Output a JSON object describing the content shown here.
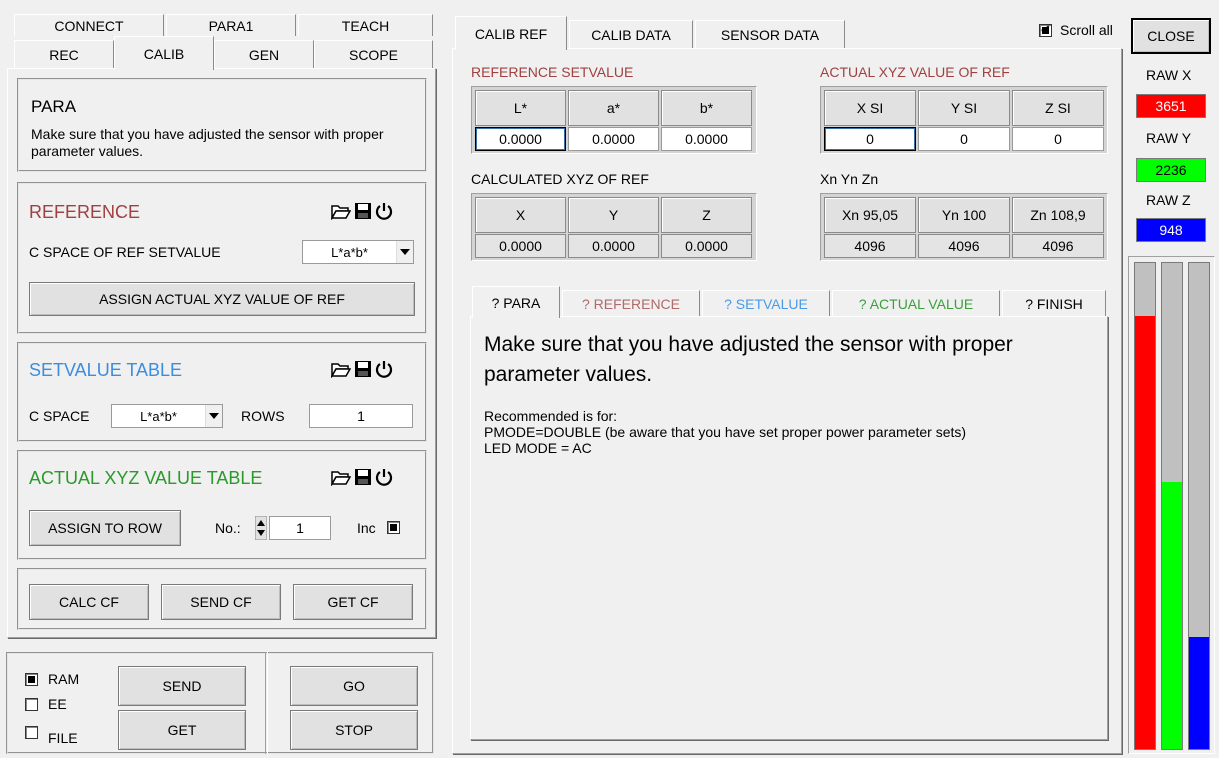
{
  "left_tabs": {
    "row1": [
      "CONNECT",
      "PARA1",
      "TEACH"
    ],
    "row2": [
      "REC",
      "CALIB",
      "GEN",
      "SCOPE"
    ],
    "active": "CALIB"
  },
  "para": {
    "title": "PARA",
    "text": "Make sure that you have adjusted the sensor with proper parameter values."
  },
  "reference": {
    "title": "REFERENCE",
    "title_color": "#a04040",
    "cspace_label": "C SPACE OF REF SETVALUE",
    "cspace_value": "L*a*b*",
    "assign_button": "ASSIGN ACTUAL XYZ VALUE OF REF"
  },
  "setvalue_table": {
    "title": "SETVALUE TABLE",
    "title_color": "#3c8ce0",
    "cspace_label": "C SPACE",
    "cspace_value": "L*a*b*",
    "rows_label": "ROWS",
    "rows_value": "1"
  },
  "actual_table": {
    "title": "ACTUAL XYZ VALUE TABLE",
    "title_color": "#2a9a2a",
    "assign_button": "ASSIGN TO ROW",
    "no_label": "No.:",
    "no_value": "1",
    "inc_label": "Inc"
  },
  "cf_buttons": {
    "calc": "CALC CF",
    "send": "SEND CF",
    "get": "GET CF"
  },
  "bottom": {
    "ram": "RAM",
    "ee": "EE",
    "file": "FILE",
    "send": "SEND",
    "get": "GET",
    "go": "GO",
    "stop": "STOP"
  },
  "right_tabs": [
    "CALIB REF",
    "CALIB DATA",
    "SENSOR DATA"
  ],
  "scroll_all": "Scroll all",
  "close": "CLOSE",
  "ref_setvalue": {
    "title": "REFERENCE SETVALUE",
    "headers": [
      "L*",
      "a*",
      "b*"
    ],
    "values": [
      "0.0000",
      "0.0000",
      "0.0000"
    ]
  },
  "actual_xyz_ref": {
    "title": "ACTUAL XYZ VALUE OF REF",
    "headers": [
      "X SI",
      "Y SI",
      "Z SI"
    ],
    "values": [
      "0",
      "0",
      "0"
    ]
  },
  "calc_xyz_ref": {
    "title": "CALCULATED XYZ  OF REF",
    "headers": [
      "X",
      "Y",
      "Z"
    ],
    "values": [
      "0.0000",
      "0.0000",
      "0.0000"
    ]
  },
  "xnynzn": {
    "title": "Xn Yn Zn",
    "headers": [
      "Xn 95,05",
      "Yn 100",
      "Zn 108,9"
    ],
    "values": [
      "4096",
      "4096",
      "4096"
    ]
  },
  "help_tabs": [
    {
      "label": "? PARA",
      "color": "#000000"
    },
    {
      "label": "? REFERENCE",
      "color": "#b06a6a"
    },
    {
      "label": "? SETVALUE",
      "color": "#4a9ae8"
    },
    {
      "label": "? ACTUAL VALUE",
      "color": "#3aa03a"
    },
    {
      "label": "? FINISH",
      "color": "#000000"
    }
  ],
  "help": {
    "heading": "Make sure that you have adjusted the sensor with proper parameter values.",
    "lines": [
      "Recommended is for:",
      "PMODE=DOUBLE (be aware that you have set proper power parameter sets)",
      "LED MODE = AC"
    ]
  },
  "raw": {
    "x_label": "RAW X",
    "x_value": "3651",
    "x_color": "#ff0000",
    "y_label": "RAW Y",
    "y_value": "2236",
    "y_color": "#00ff00",
    "z_label": "RAW Z",
    "z_value": "948",
    "z_color": "#0000ff",
    "bars": [
      {
        "name": "red",
        "level": 0.89,
        "color": "#ff0000"
      },
      {
        "name": "green",
        "level": 0.55,
        "color": "#00ff00"
      },
      {
        "name": "blue",
        "level": 0.23,
        "color": "#0000ff"
      }
    ]
  }
}
